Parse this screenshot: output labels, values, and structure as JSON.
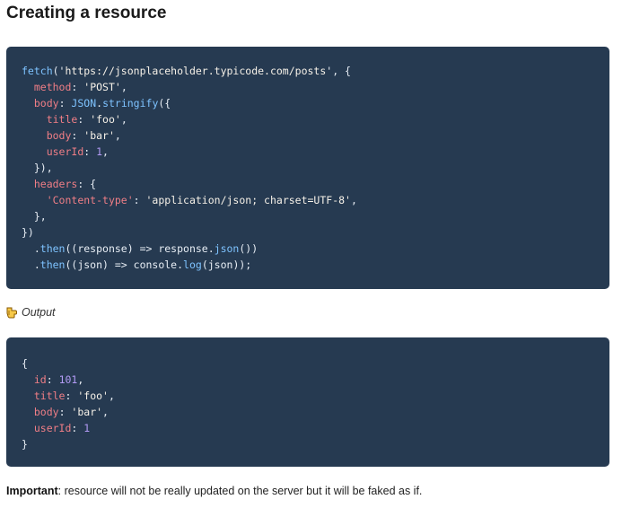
{
  "page_title": "Creating a resource",
  "request_code": {
    "lines": [
      [
        {
          "t": "fetch",
          "c": "fn"
        },
        {
          "t": "('",
          "c": "plain"
        },
        {
          "t": "https://jsonplaceholder.typicode.com/posts",
          "c": "str"
        },
        {
          "t": "', {",
          "c": "plain"
        }
      ],
      [
        {
          "t": "  ",
          "c": "plain"
        },
        {
          "t": "method",
          "c": "prop"
        },
        {
          "t": ": ",
          "c": "plain"
        },
        {
          "t": "'POST'",
          "c": "str"
        },
        {
          "t": ",",
          "c": "plain"
        }
      ],
      [
        {
          "t": "  ",
          "c": "plain"
        },
        {
          "t": "body",
          "c": "prop"
        },
        {
          "t": ": ",
          "c": "plain"
        },
        {
          "t": "JSON",
          "c": "fn"
        },
        {
          "t": ".",
          "c": "plain"
        },
        {
          "t": "stringify",
          "c": "fn"
        },
        {
          "t": "({",
          "c": "plain"
        }
      ],
      [
        {
          "t": "    ",
          "c": "plain"
        },
        {
          "t": "title",
          "c": "prop"
        },
        {
          "t": ": ",
          "c": "plain"
        },
        {
          "t": "'foo'",
          "c": "str"
        },
        {
          "t": ",",
          "c": "plain"
        }
      ],
      [
        {
          "t": "    ",
          "c": "plain"
        },
        {
          "t": "body",
          "c": "prop"
        },
        {
          "t": ": ",
          "c": "plain"
        },
        {
          "t": "'bar'",
          "c": "str"
        },
        {
          "t": ",",
          "c": "plain"
        }
      ],
      [
        {
          "t": "    ",
          "c": "plain"
        },
        {
          "t": "userId",
          "c": "prop"
        },
        {
          "t": ": ",
          "c": "plain"
        },
        {
          "t": "1",
          "c": "num"
        },
        {
          "t": ",",
          "c": "plain"
        }
      ],
      [
        {
          "t": "  }),",
          "c": "plain"
        }
      ],
      [
        {
          "t": "  ",
          "c": "plain"
        },
        {
          "t": "headers",
          "c": "prop"
        },
        {
          "t": ": {",
          "c": "plain"
        }
      ],
      [
        {
          "t": "    ",
          "c": "plain"
        },
        {
          "t": "'Content-type'",
          "c": "prop"
        },
        {
          "t": ": ",
          "c": "plain"
        },
        {
          "t": "'application/json; charset=UTF-8'",
          "c": "str"
        },
        {
          "t": ",",
          "c": "plain"
        }
      ],
      [
        {
          "t": "  },",
          "c": "plain"
        }
      ],
      [
        {
          "t": "})",
          "c": "plain"
        }
      ],
      [
        {
          "t": "  .",
          "c": "plain"
        },
        {
          "t": "then",
          "c": "fn"
        },
        {
          "t": "((response) => response.",
          "c": "plain"
        },
        {
          "t": "json",
          "c": "fn"
        },
        {
          "t": "())",
          "c": "plain"
        }
      ],
      [
        {
          "t": "  .",
          "c": "plain"
        },
        {
          "t": "then",
          "c": "fn"
        },
        {
          "t": "((json) => console.",
          "c": "plain"
        },
        {
          "t": "log",
          "c": "fn"
        },
        {
          "t": "(json));",
          "c": "plain"
        }
      ]
    ]
  },
  "output_label": "Output",
  "output_icon": "pointing-hand-icon",
  "response_code": {
    "lines": [
      [
        {
          "t": "{",
          "c": "plain"
        }
      ],
      [
        {
          "t": "  ",
          "c": "plain"
        },
        {
          "t": "id",
          "c": "prop"
        },
        {
          "t": ": ",
          "c": "plain"
        },
        {
          "t": "101",
          "c": "num"
        },
        {
          "t": ",",
          "c": "plain"
        }
      ],
      [
        {
          "t": "  ",
          "c": "plain"
        },
        {
          "t": "title",
          "c": "prop"
        },
        {
          "t": ": ",
          "c": "plain"
        },
        {
          "t": "'foo'",
          "c": "str"
        },
        {
          "t": ",",
          "c": "plain"
        }
      ],
      [
        {
          "t": "  ",
          "c": "plain"
        },
        {
          "t": "body",
          "c": "prop"
        },
        {
          "t": ": ",
          "c": "plain"
        },
        {
          "t": "'bar'",
          "c": "str"
        },
        {
          "t": ",",
          "c": "plain"
        }
      ],
      [
        {
          "t": "  ",
          "c": "plain"
        },
        {
          "t": "userId",
          "c": "prop"
        },
        {
          "t": ": ",
          "c": "plain"
        },
        {
          "t": "1",
          "c": "num"
        }
      ],
      [
        {
          "t": "}",
          "c": "plain"
        }
      ]
    ]
  },
  "note": {
    "label": "Important",
    "text": ": resource will not be really updated on the server but it will be faked as if."
  },
  "colors": {
    "code_background": "#263a51",
    "property": "#f07e86",
    "function": "#7ec3ff",
    "string": "#f6f1e8",
    "number": "#b39bf5"
  }
}
